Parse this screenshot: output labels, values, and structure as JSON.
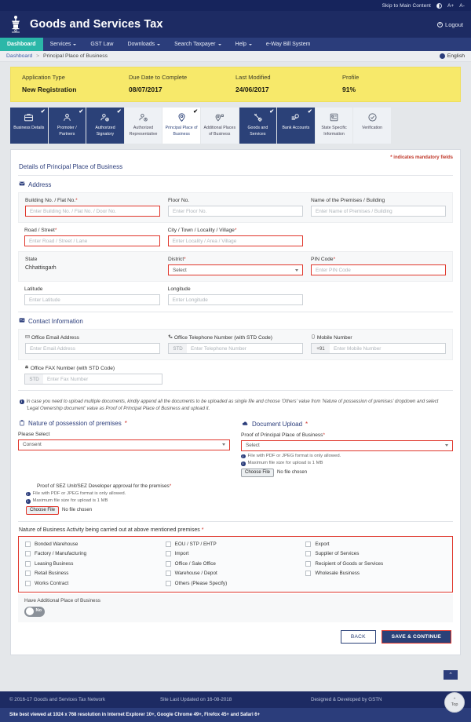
{
  "utility_bar": {
    "skip_link": "Skip to Main Content",
    "contrast_icon": "contrast-icon",
    "font_increase": "A+",
    "font_decrease": "A-"
  },
  "header": {
    "title": "Goods and Services Tax",
    "emblem_icon": "national-emblem-icon",
    "logout_label": "Logout",
    "logout_icon": "power-icon"
  },
  "nav": {
    "items": [
      {
        "label": "Dashboard",
        "active": true,
        "has_caret": false
      },
      {
        "label": "Services",
        "active": false,
        "has_caret": true
      },
      {
        "label": "GST Law",
        "active": false,
        "has_caret": false
      },
      {
        "label": "Downloads",
        "active": false,
        "has_caret": true
      },
      {
        "label": "Search Taxpayer",
        "active": false,
        "has_caret": true
      },
      {
        "label": "Help",
        "active": false,
        "has_caret": true
      },
      {
        "label": "e-Way Bill System",
        "active": false,
        "has_caret": false
      }
    ]
  },
  "breadcrumb": {
    "root": "Dashboard",
    "separator": ">",
    "current": "Principal Place of Business",
    "language": "English",
    "globe_icon": "globe-icon"
  },
  "application_info": {
    "columns": [
      {
        "key": "Application Type",
        "value": "New Registration"
      },
      {
        "key": "Due Date to Complete",
        "value": "08/07/2017"
      },
      {
        "key": "Last Modified",
        "value": "24/06/2017"
      },
      {
        "key": "Profile",
        "value": "91%"
      }
    ]
  },
  "stepper": {
    "tick_mark": "✔",
    "steps": [
      {
        "label": "Business Details",
        "icon": "briefcase-icon",
        "state": "done"
      },
      {
        "label": "Promoter / Partners",
        "icon": "user-icon",
        "state": "done"
      },
      {
        "label": "Authorized Signatory",
        "icon": "user-check-icon",
        "state": "done"
      },
      {
        "label": "Authorized Representative",
        "icon": "user-clock-icon",
        "state": "inactive"
      },
      {
        "label": "Principal Place of Business",
        "icon": "map-pin-icon",
        "state": "current"
      },
      {
        "label": "Additional Places of Business",
        "icon": "map-pin-multi-icon",
        "state": "inactive"
      },
      {
        "label": "Goods and Services",
        "icon": "goods-icon",
        "state": "done"
      },
      {
        "label": "Bank Accounts",
        "icon": "bank-icon",
        "state": "done"
      },
      {
        "label": "State Specific Information",
        "icon": "document-list-icon",
        "state": "inactive"
      },
      {
        "label": "Verification",
        "icon": "check-circle-icon",
        "state": "inactive"
      }
    ]
  },
  "form": {
    "mandatory_note": "indicates mandatory fields",
    "mandatory_star": "*",
    "page_title": "Details of Principal Place of Business",
    "address": {
      "section_title": "Address",
      "section_icon": "address-card-icon",
      "building_no": {
        "label": "Building No. / Flat No.",
        "required": true,
        "placeholder": "Enter Building No. / Flat No. / Door No.",
        "value": "",
        "error": true
      },
      "floor_no": {
        "label": "Floor No.",
        "required": false,
        "placeholder": "Enter Floor No.",
        "value": "",
        "error": false
      },
      "premises_name": {
        "label": "Name of the Premises / Building",
        "required": false,
        "placeholder": "Enter Name of Premises / Building",
        "value": "",
        "error": false
      },
      "road_street": {
        "label": "Road / Street",
        "required": true,
        "placeholder": "Enter Road / Street / Lane",
        "value": "",
        "error": true
      },
      "city_town": {
        "label": "City / Town / Locality / Village",
        "required": true,
        "placeholder": "Enter Locality / Area / Village",
        "value": "",
        "error": true
      },
      "state": {
        "label": "State",
        "required": false,
        "value": "Chhattisgarh"
      },
      "district": {
        "label": "District",
        "required": true,
        "value": "Select",
        "error": true
      },
      "pin_code": {
        "label": "PIN Code",
        "required": true,
        "placeholder": "Enter PIN Code",
        "value": "",
        "error": true
      },
      "latitude": {
        "label": "Latitude",
        "required": false,
        "placeholder": "Enter Latitude",
        "value": "",
        "error": false
      },
      "longitude": {
        "label": "Longitude",
        "required": false,
        "placeholder": "Enter Longitude",
        "value": "",
        "error": false
      }
    },
    "contact": {
      "section_title": "Contact Information",
      "section_icon": "contact-card-icon",
      "email": {
        "label": "Office Email Address",
        "icon": "envelope-icon",
        "placeholder": "Enter Email Address",
        "value": ""
      },
      "telephone": {
        "label": "Office Telephone Number (with STD Code)",
        "icon": "phone-icon",
        "std_placeholder": "STD",
        "placeholder": "Enter Telephone Number",
        "value": ""
      },
      "mobile": {
        "label": "Mobile Number",
        "icon": "mobile-icon",
        "prefix": "+91",
        "placeholder": "Enter Mobile Number",
        "value": ""
      },
      "fax": {
        "label": "Office FAX Number (with STD Code)",
        "icon": "fax-icon",
        "std_placeholder": "STD",
        "placeholder": "Enter Fax Number",
        "value": ""
      }
    },
    "upload_note": "In case you need to upload multiple documents, kindly append all the documents to be uploaded as single file and choose 'Others' value from 'Nature of possession of premises' dropdown and select 'Legal Ownership document' value as Proof of Principal Place of Business and upload it.",
    "possession": {
      "section_title": "Nature of possession of premises",
      "section_icon": "clipboard-icon",
      "required": true,
      "sub_label": "Please Select",
      "value": "Consent",
      "error": true
    },
    "document_upload": {
      "section_title": "Document Upload",
      "section_icon": "cloud-upload-icon",
      "required": true,
      "proof_label": "Proof of Principal Place of Business",
      "proof_value": "Select",
      "proof_error": true,
      "hint_format": "File with PDF or JPEG format is only allowed.",
      "hint_size": "Maximum file size for upload is 1 MB",
      "choose_file_label": "Choose File",
      "no_file_text": "No file chosen"
    },
    "sez": {
      "label": "Proof of SEZ Unit/SEZ Developer approval for the premises",
      "required": true,
      "hint_format": "File with PDF or JPEG format is only allowed.",
      "hint_size": "Maximum file size for upload is 1 MB",
      "choose_file_label": "Choose File",
      "no_file_text": "No file chosen",
      "choose_error": true
    },
    "business_activity": {
      "label": "Nature of Business Activity being carried out at above mentioned premises",
      "required": true,
      "error": true,
      "columns": [
        [
          "Bonded Warehouse",
          "Factory / Manufacturing",
          "Leasing Business",
          "Retail Business",
          "Works Contract"
        ],
        [
          "EOU / STP / EHTP",
          "Import",
          "Office / Sale Office",
          "Warehouse / Depot",
          "Others (Please Specify)"
        ],
        [
          "Export",
          "Supplier of Services",
          "Recipient of Goods or Services",
          "Wholesale Business"
        ]
      ]
    },
    "additional_place": {
      "label": "Have Additional Place of Business",
      "toggle_value": "No",
      "toggle_on": false
    },
    "buttons": {
      "back": "BACK",
      "save_continue": "SAVE & CONTINUE"
    }
  },
  "footer": {
    "copyright": "© 2016-17 Goods and Services Tax Network",
    "last_updated": "Site Last Updated on 16-08-2018",
    "developed_by": "Designed & Developed by GSTN",
    "browser_note": "Site best viewed at 1024 x 768 resolution in Internet Explorer 10+, Google Chrome 49+, Firefox 45+ and Safari 6+",
    "to_top_label": "Top",
    "to_top_icon": "chevron-up-icon"
  },
  "colors": {
    "header_navy": "#1d2b63",
    "nav_blue": "#2b3d7b",
    "active_teal": "#2bb7a8",
    "banner_yellow": "#f7e96a",
    "error_red": "#e0372c",
    "step_blue": "#2b4178"
  }
}
